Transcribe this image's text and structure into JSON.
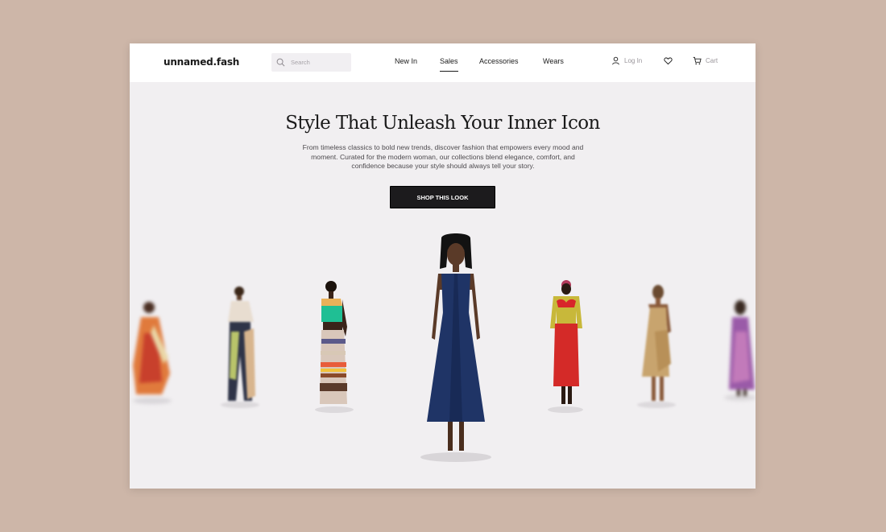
{
  "brand": {
    "logo_text": "unnamed.fash"
  },
  "search": {
    "placeholder": "Search",
    "icon": "search-icon"
  },
  "nav": {
    "items": [
      {
        "label": "New In",
        "active": false
      },
      {
        "label": "Sales",
        "active": true
      },
      {
        "label": "Accessories",
        "active": false
      },
      {
        "label": "Wears",
        "active": false
      }
    ]
  },
  "header_actions": {
    "login_label": "Log In",
    "login_icon": "user-icon",
    "wishlist_icon": "heart-icon",
    "cart_label": "Cart",
    "cart_icon": "cart-icon"
  },
  "hero": {
    "title": "Style That Unleash Your Inner Icon",
    "subtitle": "From timeless classics to bold new trends, discover fashion that empowers every mood and moment. Curated for the modern woman, our collections blend elegance, comfort, and confidence because your style should always tell your story.",
    "cta_label": "SHOP THIS LOOK"
  },
  "colors": {
    "page_bg": "#cdb6a8",
    "hero_bg": "#f1eff1",
    "cta_bg": "#1c1b1d"
  }
}
